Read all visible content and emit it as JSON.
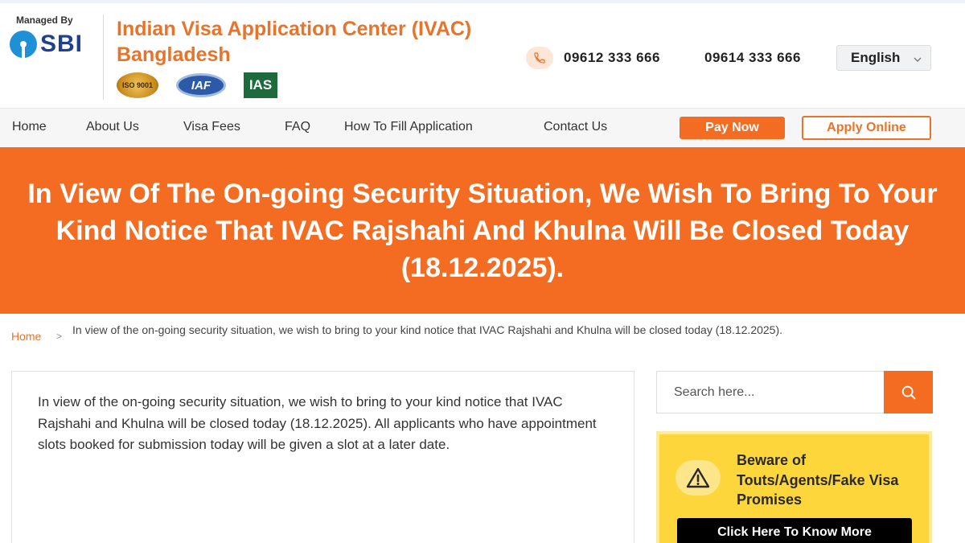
{
  "header": {
    "managed_by": "Managed By",
    "sbi_text": "SBI",
    "title": "Indian Visa Application Center (IVAC) Bangladesh",
    "certs": {
      "iso": "ISO 9001",
      "iaf": "IAF",
      "ias": "IAS"
    },
    "phone_1": "09612 333 666",
    "phone_2": "09614 333 666",
    "language": "English"
  },
  "nav": {
    "items": [
      "Home",
      "About Us",
      "Visa Fees",
      "FAQ",
      "How To Fill Application",
      "Contact Us"
    ],
    "pay_now": "Pay Now",
    "apply_online": "Apply Online"
  },
  "banner": {
    "text": "In View Of The On-going Security Situation, We Wish To Bring To Your Kind Notice That IVAC Rajshahi And Khulna Will Be Closed Today (18.12.2025)."
  },
  "breadcrumb": {
    "home": "Home",
    "separator": ">",
    "current": "In view of the on-going security situation, we wish to bring to your kind notice that IVAC Rajshahi and Khulna will be closed today (18.12.2025)."
  },
  "article": {
    "body": "In view of the on-going security situation, we wish to bring to your kind notice that IVAC Rajshahi and Khulna will be closed today (18.12.2025). All applicants who have appointment slots booked for submission today will be given a slot at a later date."
  },
  "sidebar": {
    "search_placeholder": "Search here...",
    "warning_title": "Beware of Touts/Agents/Fake Visa Promises",
    "warning_button": "Click Here To Know More"
  },
  "colors": {
    "accent": "#f36c21",
    "title_orange": "#e8732a",
    "warning_yellow": "#fcd63b"
  },
  "icons": {
    "phone": "phone-icon",
    "language_dropdown": "chevron-down-icon",
    "search": "search-icon",
    "warning": "warning-triangle-icon"
  }
}
